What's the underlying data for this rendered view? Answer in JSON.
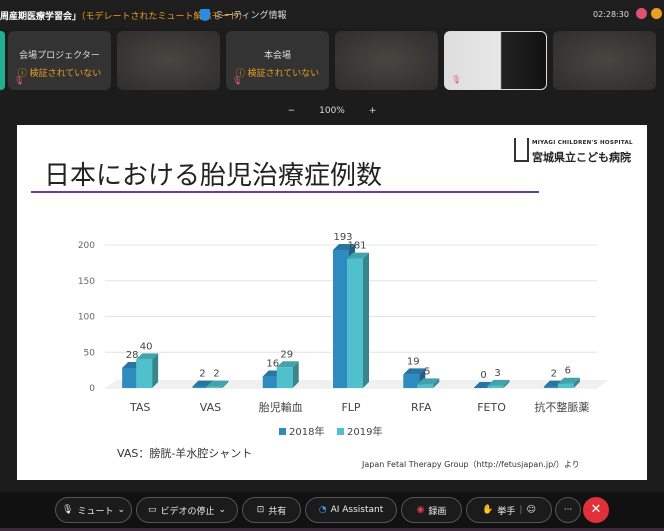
{
  "meeting": {
    "title": "周産期医療学習会」",
    "mode": "（モデレートされたミュート解除モード）",
    "info_label": "ミーティング情報",
    "clock": "02:28:30"
  },
  "participants": [
    {
      "name": "会場プロジェクター",
      "status": "検証されていない"
    },
    {
      "name": "",
      "status": ""
    },
    {
      "name": "本会場",
      "status": "検証されていない"
    },
    {
      "name": "",
      "status": ""
    },
    {
      "name": "",
      "status": ""
    },
    {
      "name": "",
      "status": ""
    }
  ],
  "zoom": {
    "minus": "−",
    "level": "100%",
    "plus": "+"
  },
  "slide": {
    "title": "日本における胎児治療症例数",
    "logo_en": "MIYAGI CHILDREN'S HOSPITAL",
    "logo_jp": "宮城県立こども病院",
    "note": "VAS：膀胱-羊水腔シャント",
    "source": "Japan Fetal Therapy Group（http://fetusjapan.jp/）より"
  },
  "chart_data": {
    "type": "bar",
    "categories": [
      "TAS",
      "VAS",
      "胎児輸血",
      "FLP",
      "RFA",
      "FETO",
      "抗不整脈薬"
    ],
    "series": [
      {
        "name": "2018年",
        "values": [
          28,
          2,
          16,
          193,
          19,
          0,
          2
        ],
        "color": "#2e8bbf"
      },
      {
        "name": "2019年",
        "values": [
          40,
          2,
          29,
          181,
          5,
          3,
          6
        ],
        "color": "#4fc0cc"
      }
    ],
    "yticks": [
      "0",
      "50",
      "100",
      "150",
      "200"
    ],
    "ylim": [
      0,
      200
    ],
    "legend": "bottom",
    "style": "3d-clustered-column"
  },
  "toolbar": {
    "mute": "ミュート",
    "video": "ビデオの停止",
    "share": "共有",
    "ai": "AI Assistant",
    "record": "録画",
    "raise": "挙手",
    "more": "···",
    "end": "✕"
  }
}
